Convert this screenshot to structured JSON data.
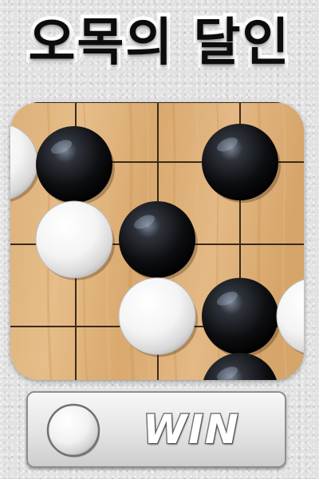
{
  "title": "오목의 달인",
  "board": {
    "colors": {
      "wood_light": "#e2b884",
      "wood_dark": "#cc9455",
      "grid_line": "#3a2a18"
    },
    "stones": [
      {
        "color": "white",
        "col": 0,
        "row": 0,
        "partial": true
      },
      {
        "color": "black",
        "col": 1,
        "row": 0
      },
      {
        "color": "black",
        "col": 3,
        "row": 0
      },
      {
        "color": "white",
        "col": 1,
        "row": 1
      },
      {
        "color": "black",
        "col": 2,
        "row": 1
      },
      {
        "color": "white",
        "col": 2,
        "row": 2
      },
      {
        "color": "black",
        "col": 3,
        "row": 2
      },
      {
        "color": "white",
        "col": 4,
        "row": 2,
        "partial": true
      },
      {
        "color": "black",
        "col": 3,
        "row": 3,
        "partial": true
      }
    ]
  },
  "status": {
    "label": "WIN",
    "stone_color": "white"
  }
}
